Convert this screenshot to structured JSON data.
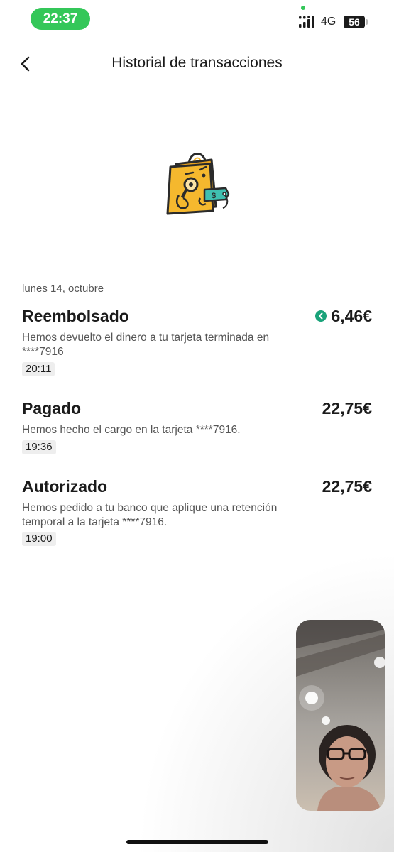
{
  "status_bar": {
    "time": "22:37",
    "network": "4G",
    "battery": "56"
  },
  "header": {
    "title": "Historial de transacciones",
    "back_icon": "chevron-left-icon"
  },
  "illustration": {
    "icon": "shopping-bag-with-magnifier-and-price-tag-icon",
    "tag_symbol": "$",
    "colors": {
      "bag": "#f5b82e",
      "outline": "#2b2b2b",
      "tag": "#3fc0b0"
    }
  },
  "date_heading": "lunes 14, octubre",
  "transactions": [
    {
      "title": "Reembolsado",
      "amount": "6,46€",
      "refund_icon": "arrow-left-circle-icon",
      "refund_icon_color": "#1aa37a",
      "description": "Hemos devuelto el dinero a tu tarjeta terminada en ****7916",
      "time": "20:11"
    },
    {
      "title": "Pagado",
      "amount": "22,75€",
      "description": "Hemos hecho el cargo en la tarjeta ****7916.",
      "time": "19:36"
    },
    {
      "title": "Autorizado",
      "amount": "22,75€",
      "description": "Hemos pedido a tu banco que aplique una retención temporal a la tarjeta ****7916.",
      "time": "19:00"
    }
  ],
  "pip_video": {
    "icon": "video-call-thumbnail"
  }
}
